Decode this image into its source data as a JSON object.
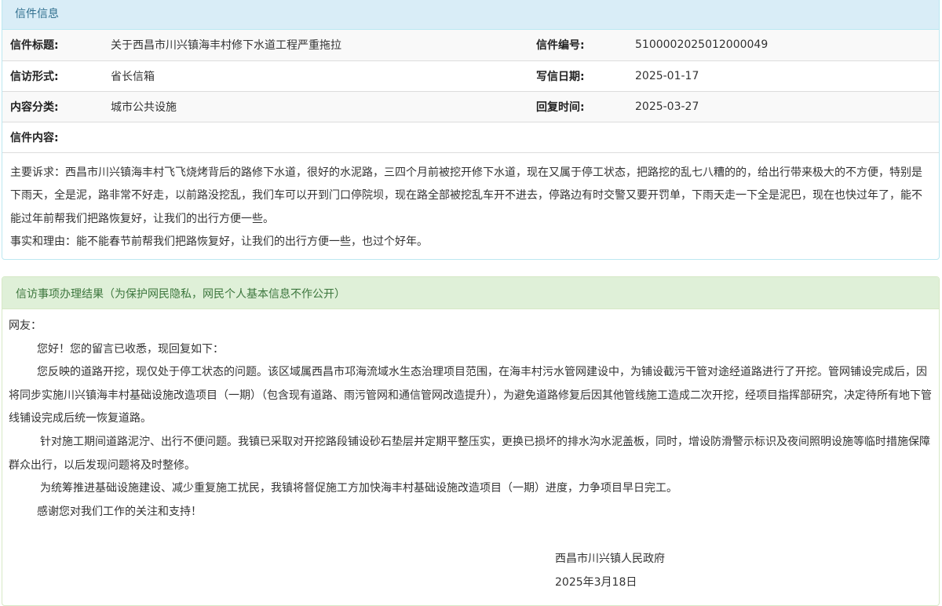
{
  "letter_panel": {
    "heading": "信件信息",
    "fields": {
      "title_label": "信件标题:",
      "title_value": "关于西昌市川兴镇海丰村修下水道工程严重拖拉",
      "number_label": "信件编号:",
      "number_value": "510000202501200004​9",
      "form_label": "信访形式:",
      "form_value": "省长信箱",
      "date_label": "写信日期:",
      "date_value": "2025-01-17",
      "category_label": "内容分类:",
      "category_value": "城市公共设施",
      "reply_time_label": "回复时间:",
      "reply_time_value": "2025-03-27",
      "content_label": "信件内容:"
    },
    "content": {
      "appeal": "主要诉求：西昌市川兴镇海丰村飞飞烧烤背后的路修下水道，很好的水泥路，三四个月前被挖开修下水道，现在又属于停工状态，把路挖的乱七八糟的的，给出行带来极大的不方便，特别是下雨天，全是泥，路非常不好走，以前路没挖乱，我们车可以开到门口停院坝，现在路全部被挖乱车开不进去，停路边有时交警又要开罚单，下雨天走一下全是泥巴，现在也快过年了，能不能过年前帮我们把路恢复好，让我们的出行方便一些。",
      "reason": "事实和理由：能不能春节前帮我们把路恢复好，让我们的出行方便一些，也过个好年。"
    }
  },
  "result_panel": {
    "heading": "信访事项办理结果（为保护网民隐私，网民个人基本信息不作公开）",
    "greeting": "网友：",
    "paragraphs": [
      "您好！您的留言已收悉，现回复如下：",
      "您反映的道路开挖，现仅处于停工状态的问题。该区域属西昌市邛海流域水生态治理项目范围，在海丰村污水管网建设中，为铺设截污干管对途经道路进行了开挖。管网铺设完成后，因将同步实施川兴镇海丰村基础设施改造项目（一期）（包含现有道路、雨污管网和通信管网改造提升），为避免道路修复后因其他管线施工造成二次开挖，经项目指挥部研究，决定待所有地下管线铺设完成后统一恢复道路。",
      "针对施工期间道路泥泞、出行不便问题。我镇已采取对开挖路段铺设砂石垫层并定期平整压实，更换已损坏的排水沟水泥盖板，同时，增设防滑警示标识及夜间照明设施等临时措施保障群众出行，以后发现问题将及时整修。",
      "为统筹推进基础设施建设、减少重复施工扰民，我镇将督促施工方加快海丰村基础设施改造项目（一期）进度，力争项目早日完工。",
      "感谢您对我们工作的关注和支持！"
    ],
    "signature": {
      "org": "西昌市川兴镇人民政府",
      "date": "2025年3月18日"
    }
  }
}
